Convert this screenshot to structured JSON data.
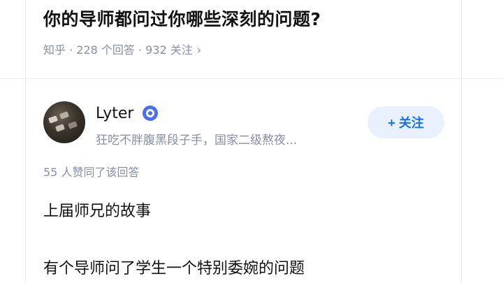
{
  "question": {
    "title": "你的导师都问过你哪些深刻的问题?",
    "meta": "知乎 · 228 个回答 · 932 关注",
    "meta_chevron": "›"
  },
  "author": {
    "name": "Lyter",
    "badge_icon": "verified-badge-icon",
    "bio": "狂吃不胖腹黑段子手，国家二级熬夜...",
    "follow_label": "+ 关注"
  },
  "answer": {
    "votes": "55 人赞同了该回答",
    "paragraphs": [
      "上届师兄的故事",
      "有个导师问了学生一个特别委婉的问题"
    ]
  },
  "colors": {
    "accent": "#1772f6",
    "follow_bg": "#e9f1ff",
    "meta_gray": "#8590a6",
    "badge_blue": "#4e6ef2"
  }
}
